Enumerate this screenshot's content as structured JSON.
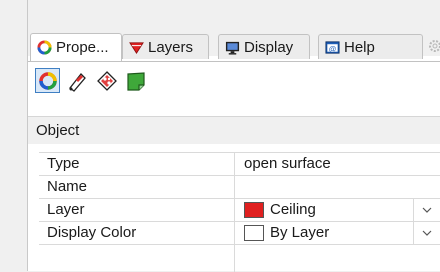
{
  "tabs": [
    {
      "label": "Prope...",
      "icon": "properties-icon",
      "active": true
    },
    {
      "label": "Layers",
      "icon": "layers-icon",
      "active": false
    },
    {
      "label": "Display",
      "icon": "display-icon",
      "active": false
    },
    {
      "label": "Help",
      "icon": "help-icon",
      "active": false
    }
  ],
  "toolbar_icons": [
    "object-properties-icon",
    "material-icon",
    "decal-icon",
    "texture-mapping-icon"
  ],
  "section": {
    "header": "Object"
  },
  "properties": [
    {
      "label": "Type",
      "value": "open surface"
    },
    {
      "label": "Name",
      "value": ""
    },
    {
      "label": "Layer",
      "value": "Ceiling",
      "swatch": "#e02020",
      "dropdown": true
    },
    {
      "label": "Display Color",
      "value": "By Layer",
      "swatch": "#ffffff",
      "dropdown": true
    }
  ],
  "colors": {
    "accent": "#3f7fc3",
    "layer_swatch": "#e02020"
  }
}
